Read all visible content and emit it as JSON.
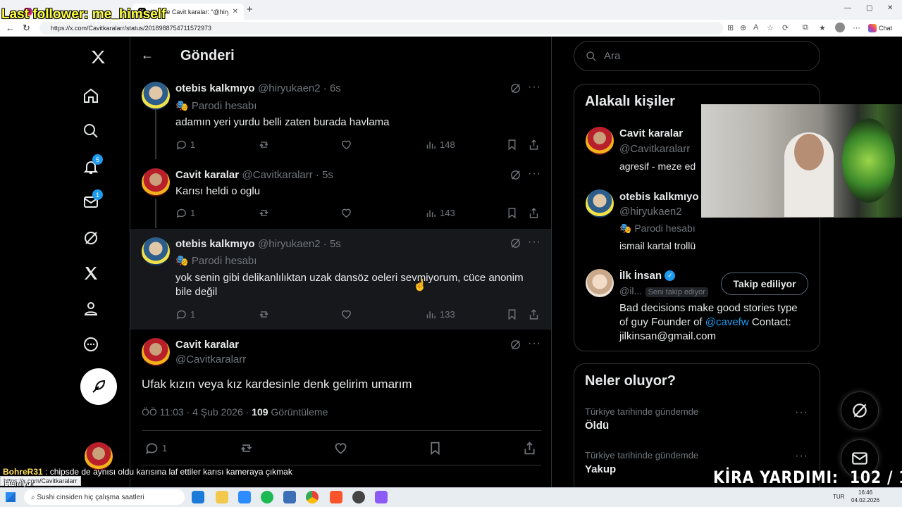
{
  "browser": {
    "tabs": [
      {
        "title": "Instagram"
      },
      {
        "title": "(6) X'te Cavit karalar: \"@hiryukaen\""
      }
    ],
    "url": "https://x.com/Cavitkaralarr/status/2018988754711572973",
    "chat_label": "Chat"
  },
  "overlay": {
    "last_follower": "Last follower: me_himself",
    "kira_label": "KİRA YARDIMI:",
    "kira_value": "102 / 110",
    "chat_user": "BohreR31",
    "chat_message": " : chipsde de aynısı oldu karısına laf ettiler karısı kameraya çıkmak",
    "chat_cont": "istemiyor",
    "hover_url": "https://x.com/Cavitkaralarr"
  },
  "nav": {
    "notifications_count": "5",
    "messages_count": "1"
  },
  "header": {
    "title": "Gönderi"
  },
  "replies": [
    {
      "name": "otebis kalkmıyo",
      "handle": "@hiryukaen2 · 6s",
      "parody": "Parodi hesabı",
      "text": "adamın yeri yurdu belli zaten burada havlama",
      "replies": "1",
      "views": "148"
    },
    {
      "name": "Cavit karalar",
      "handle": "@Cavitkaralarr · 5s",
      "text": "Karısı heldi o oglu",
      "replies": "1",
      "views": "143"
    },
    {
      "name": "otebis kalkmıyo",
      "handle": "@hiryukaen2 · 5s",
      "parody": "Parodi hesabı",
      "text": "yok senin gibi delikanlılıktan uzak dansöz oeleri sevmiyorum, cüce anonim bile değil",
      "replies": "1",
      "views": "133"
    }
  ],
  "main_post": {
    "name": "Cavit karalar",
    "handle": "@Cavitkaralarr",
    "text": "Ufak kızın veya kız kardesinle denk gelirim umarım",
    "time": "ÖÖ 11:03 · 4 Şub 2026 · ",
    "views": "109",
    "views_label": " Görüntüleme",
    "replies": "1"
  },
  "search": {
    "placeholder": "Ara"
  },
  "related": {
    "title": "Alakalı kişiler",
    "people": [
      {
        "name": "Cavit karalar",
        "handle": "@Cavitkaralarr",
        "bio": "agresif - meze ed"
      },
      {
        "name": "otebis kalkmıyo",
        "handle": "@hiryukaen2",
        "parody": "Parodi hesabı",
        "bio": "ismail kartal trollü"
      },
      {
        "name": "İlk İnsan",
        "handle": "@il...",
        "follows_you": "Seni takip ediyor",
        "follow_button": "Takip ediliyor",
        "bio1": "Bad decisions make good stories type",
        "bio2a": "of guy Founder of ",
        "bio2link": "@cavefw",
        "bio2b": " Contact:",
        "bio3": "jilkinsan@gmail.com"
      }
    ]
  },
  "trends": {
    "title": "Neler oluyor?",
    "items": [
      {
        "context": "Türkiye tarihinde gündemde",
        "name": "Öldü"
      },
      {
        "context": "Türkiye tarihinde gündemde",
        "name": "Yakup"
      }
    ]
  },
  "taskbar": {
    "search_placeholder": "Sushi cinsiden hiç çalışma saatleri",
    "lang": "TUR",
    "time": "16:46",
    "date": "04.02.2026"
  }
}
